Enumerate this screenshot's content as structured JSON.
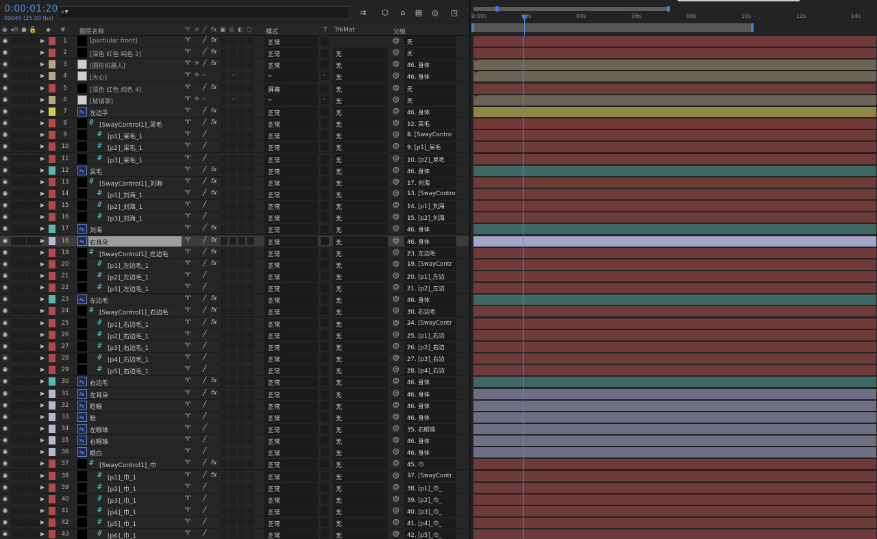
{
  "header": {
    "timecode": "0:00:01:20",
    "frame_info": "00045 (25.00 fps)",
    "search_placeholder": "⌕"
  },
  "columns": {
    "number": "#",
    "layer_name": "图层名称",
    "mode": "模式",
    "t": "T",
    "trkmat": "TrkMat",
    "parent": "父级"
  },
  "timeline": {
    "ticks": [
      "0:00s",
      "02s",
      "04s",
      "06s",
      "08s",
      "10s",
      "12s",
      "14s"
    ],
    "playhead_seconds": 1.8,
    "duration_seconds": 15
  },
  "colors": {
    "red": "#b7464b",
    "tan": "#b5a58a",
    "yellow": "#d8c95a",
    "aqua": "#57b8b1",
    "lavender": "#b9b6d4",
    "bar_red": "#6e3a3a",
    "bar_tan": "#6b6356",
    "bar_yellow": "#8e8648",
    "bar_aqua": "#3d6866",
    "bar_lavender": "#6f6f83",
    "bar_selected": "#a3a6c8",
    "accent": "#3f7fd8"
  },
  "layers": [
    {
      "num": "1",
      "label": "red",
      "thumb": "null",
      "name": "[partiular front]",
      "indent": 0,
      "sw2": "",
      "fx": true,
      "mode": "正常",
      "trk": "",
      "trk_show": false,
      "parent": "无"
    },
    {
      "num": "2",
      "label": "red",
      "thumb": "null",
      "name": "[深色 红色 纯色 2]",
      "indent": 0,
      "sw2": "",
      "fx": true,
      "mode": "正常",
      "trk": "无",
      "trk_show": true,
      "parent": "无"
    },
    {
      "num": "3",
      "label": "tan",
      "thumb": "comp",
      "name": "[圆形机器人]",
      "indent": 0,
      "sw2": "☼",
      "fx": true,
      "mode": "正常",
      "trk": "无",
      "trk_show": true,
      "parent": "46. 身体"
    },
    {
      "num": "4",
      "label": "tan",
      "thumb": "comp",
      "name": "[大心]",
      "indent": 0,
      "sw2": "☼",
      "fx": false,
      "mode": "-",
      "trk": "无",
      "trk_show": true,
      "parent": "46. 身体",
      "dash": true
    },
    {
      "num": "5",
      "label": "red",
      "thumb": "null",
      "name": "[深色 红色 纯色 4]",
      "indent": 0,
      "sw2": "",
      "fx": true,
      "mode": "屏幕",
      "trk": "无",
      "trk_show": true,
      "parent": "无"
    },
    {
      "num": "6",
      "label": "tan",
      "thumb": "comp",
      "name": "[玻璃罩]",
      "indent": 0,
      "sw2": "☼",
      "fx": false,
      "mode": "-",
      "trk": "无",
      "trk_show": true,
      "parent": "无",
      "dash": true
    },
    {
      "num": "7",
      "label": "yellow",
      "thumb": "ps",
      "name": "左边手",
      "indent": 0,
      "sw2": "",
      "fx": true,
      "mode": "正常",
      "trk": "无",
      "trk_show": true,
      "parent": "46. 身体"
    },
    {
      "num": "8",
      "label": "red",
      "thumb": "hash",
      "name": "[SwayControl1]_呆毛",
      "indent": 1,
      "sw2": "",
      "fx": true,
      "mode": "正常",
      "trk": "无",
      "trk_show": true,
      "parent": "12. 呆毛"
    },
    {
      "num": "9",
      "label": "red",
      "thumb": "hash",
      "name": "[p1]_呆毛_1",
      "indent": 2,
      "sw2": "",
      "fx": false,
      "mode": "正常",
      "trk": "无",
      "trk_show": true,
      "parent": "8. [SwayContro"
    },
    {
      "num": "10",
      "label": "red",
      "thumb": "hash",
      "name": "[p2]_呆毛_1",
      "indent": 2,
      "sw2": "",
      "fx": false,
      "mode": "正常",
      "trk": "无",
      "trk_show": true,
      "parent": "9.   [p1]_呆毛"
    },
    {
      "num": "11",
      "label": "red",
      "thumb": "hash",
      "name": "[p3]_呆毛_1",
      "indent": 2,
      "sw2": "",
      "fx": false,
      "mode": "正常",
      "trk": "无",
      "trk_show": true,
      "parent": "10.   [p2]_呆毛"
    },
    {
      "num": "12",
      "label": "aqua",
      "thumb": "ps",
      "name": "呆毛",
      "indent": 0,
      "sw2": "",
      "fx": true,
      "mode": "正常",
      "trk": "无",
      "trk_show": true,
      "parent": "46. 身体"
    },
    {
      "num": "13",
      "label": "red",
      "thumb": "hash",
      "name": "[SwayControl1]_刘海",
      "indent": 1,
      "sw2": "",
      "fx": true,
      "mode": "正常",
      "trk": "无",
      "trk_show": true,
      "parent": "17. 刘海"
    },
    {
      "num": "14",
      "label": "red",
      "thumb": "hash",
      "name": "[p1]_刘海_1",
      "indent": 2,
      "sw2": "",
      "fx": true,
      "mode": "正常",
      "trk": "无",
      "trk_show": true,
      "parent": "13. [SwayContro"
    },
    {
      "num": "15",
      "label": "red",
      "thumb": "hash",
      "name": "[p2]_刘海_1",
      "indent": 2,
      "sw2": "",
      "fx": false,
      "mode": "正常",
      "trk": "无",
      "trk_show": true,
      "parent": "14.   [p1]_刘海"
    },
    {
      "num": "16",
      "label": "red",
      "thumb": "hash",
      "name": "[p3]_刘海_1",
      "indent": 2,
      "sw2": "",
      "fx": false,
      "mode": "正常",
      "trk": "无",
      "trk_show": true,
      "parent": "15.   [p2]_刘海"
    },
    {
      "num": "17",
      "label": "aqua",
      "thumb": "ps",
      "name": "刘海",
      "indent": 0,
      "sw2": "",
      "fx": true,
      "mode": "正常",
      "trk": "无",
      "trk_show": true,
      "parent": "46. 身体"
    },
    {
      "num": "18",
      "label": "lavender",
      "thumb": "ps",
      "name": "右耳朵",
      "indent": 0,
      "sw2": "",
      "fx": true,
      "mode": "正常",
      "trk": "无",
      "trk_show": true,
      "parent": "46. 身体",
      "selected": true
    },
    {
      "num": "19",
      "label": "red",
      "thumb": "hash",
      "name": "[SwayControl1]_左边毛",
      "indent": 1,
      "sw2": "",
      "fx": true,
      "mode": "正常",
      "trk": "无",
      "trk_show": true,
      "parent": "23. 左边毛"
    },
    {
      "num": "20",
      "label": "red",
      "thumb": "hash",
      "name": "[p1]_左边毛_1",
      "indent": 2,
      "sw2": "",
      "fx": true,
      "mode": "正常",
      "trk": "无",
      "trk_show": true,
      "parent": "19. [SwayContr"
    },
    {
      "num": "21",
      "label": "red",
      "thumb": "hash",
      "name": "[p2]_左边毛_1",
      "indent": 2,
      "sw2": "",
      "fx": false,
      "mode": "正常",
      "trk": "无",
      "trk_show": true,
      "parent": "20.   [p1]_左边"
    },
    {
      "num": "22",
      "label": "red",
      "thumb": "hash",
      "name": "[p3]_左边毛_1",
      "indent": 2,
      "sw2": "",
      "fx": false,
      "mode": "正常",
      "trk": "无",
      "trk_show": true,
      "parent": "21.   [p2]_左边"
    },
    {
      "num": "23",
      "label": "aqua",
      "thumb": "ps",
      "name": "左边毛",
      "indent": 0,
      "sw2": "",
      "fx": true,
      "mode": "正常",
      "trk": "无",
      "trk_show": true,
      "parent": "46. 身体"
    },
    {
      "num": "24",
      "label": "red",
      "thumb": "hash",
      "name": "[SwayControl1]_右边毛",
      "indent": 1,
      "sw2": "",
      "fx": true,
      "mode": "正常",
      "trk": "无",
      "trk_show": true,
      "parent": "30. 右边毛"
    },
    {
      "num": "25",
      "label": "red",
      "thumb": "hash",
      "name": "[p1]_右边毛_1",
      "indent": 2,
      "sw2": "",
      "fx": true,
      "mode": "正常",
      "trk": "无",
      "trk_show": true,
      "parent": "24. [SwayContr"
    },
    {
      "num": "26",
      "label": "red",
      "thumb": "hash",
      "name": "[p2]_右边毛_1",
      "indent": 2,
      "sw2": "",
      "fx": false,
      "mode": "正常",
      "trk": "无",
      "trk_show": true,
      "parent": "25.   [p1]_右边"
    },
    {
      "num": "27",
      "label": "red",
      "thumb": "hash",
      "name": "[p3]_右边毛_1",
      "indent": 2,
      "sw2": "",
      "fx": false,
      "mode": "正常",
      "trk": "无",
      "trk_show": true,
      "parent": "26.   [p2]_右边"
    },
    {
      "num": "28",
      "label": "red",
      "thumb": "hash",
      "name": "[p4]_右边毛_1",
      "indent": 2,
      "sw2": "",
      "fx": false,
      "mode": "正常",
      "trk": "无",
      "trk_show": true,
      "parent": "27.   [p3]_右边"
    },
    {
      "num": "29",
      "label": "red",
      "thumb": "hash",
      "name": "[p5]_右边毛_1",
      "indent": 2,
      "sw2": "",
      "fx": false,
      "mode": "正常",
      "trk": "无",
      "trk_show": true,
      "parent": "28.   [p4]_右边"
    },
    {
      "num": "30",
      "label": "aqua",
      "thumb": "ps",
      "name": "右边毛",
      "indent": 0,
      "sw2": "",
      "fx": true,
      "mode": "正常",
      "trk": "无",
      "trk_show": true,
      "parent": "46. 身体"
    },
    {
      "num": "31",
      "label": "lavender",
      "thumb": "ps",
      "name": "左耳朵",
      "indent": 0,
      "sw2": "",
      "fx": true,
      "mode": "正常",
      "trk": "无",
      "trk_show": true,
      "parent": "46. 身体"
    },
    {
      "num": "32",
      "label": "lavender",
      "thumb": "ps",
      "name": "眨眼",
      "indent": 0,
      "sw2": "",
      "fx": false,
      "mode": "正常",
      "trk": "无",
      "trk_show": true,
      "parent": "46. 身体"
    },
    {
      "num": "33",
      "label": "lavender",
      "thumb": "ps",
      "name": "脸",
      "indent": 0,
      "sw2": "",
      "fx": false,
      "mode": "正常",
      "trk": "无",
      "trk_show": true,
      "parent": "46. 身体"
    },
    {
      "num": "34",
      "label": "lavender",
      "thumb": "ps",
      "name": "左眼珠",
      "indent": 0,
      "sw2": "",
      "fx": false,
      "mode": "正常",
      "trk": "无",
      "trk_show": true,
      "parent": "35. 右眼珠"
    },
    {
      "num": "35",
      "label": "lavender",
      "thumb": "ps",
      "name": "右眼珠",
      "indent": 0,
      "sw2": "",
      "fx": false,
      "mode": "正常",
      "trk": "无",
      "trk_show": true,
      "parent": "46. 身体"
    },
    {
      "num": "36",
      "label": "lavender",
      "thumb": "ps",
      "name": "眼白",
      "indent": 0,
      "sw2": "",
      "fx": false,
      "mode": "正常",
      "trk": "无",
      "trk_show": true,
      "parent": "46. 身体"
    },
    {
      "num": "37",
      "label": "red",
      "thumb": "hash",
      "name": "[SwayControl1]_巾",
      "indent": 1,
      "sw2": "",
      "fx": true,
      "mode": "正常",
      "trk": "无",
      "trk_show": true,
      "parent": "45. 巾"
    },
    {
      "num": "38",
      "label": "red",
      "thumb": "hash",
      "name": "[p1]_巾_1",
      "indent": 2,
      "sw2": "",
      "fx": true,
      "mode": "正常",
      "trk": "无",
      "trk_show": true,
      "parent": "37. [SwayContr"
    },
    {
      "num": "39",
      "label": "red",
      "thumb": "hash",
      "name": "[p2]_巾_1",
      "indent": 2,
      "sw2": "",
      "fx": false,
      "mode": "正常",
      "trk": "无",
      "trk_show": true,
      "parent": "38.   [p1]_巾_"
    },
    {
      "num": "40",
      "label": "red",
      "thumb": "hash",
      "name": "[p3]_巾_1",
      "indent": 2,
      "sw2": "",
      "fx": false,
      "mode": "正常",
      "trk": "无",
      "trk_show": true,
      "parent": "39.   [p2]_巾_"
    },
    {
      "num": "41",
      "label": "red",
      "thumb": "hash",
      "name": "[p4]_巾_1",
      "indent": 2,
      "sw2": "",
      "fx": false,
      "mode": "正常",
      "trk": "无",
      "trk_show": true,
      "parent": "40.   [p3]_巾_"
    },
    {
      "num": "42",
      "label": "red",
      "thumb": "hash",
      "name": "[p5]_巾_1",
      "indent": 2,
      "sw2": "",
      "fx": false,
      "mode": "正常",
      "trk": "无",
      "trk_show": true,
      "parent": "41.   [p4]_巾_"
    },
    {
      "num": "43",
      "label": "red",
      "thumb": "hash",
      "name": "[p6]_巾_1",
      "indent": 2,
      "sw2": "",
      "fx": false,
      "mode": "正常",
      "trk": "无",
      "trk_show": true,
      "parent": "42.   [p5]_巾_"
    }
  ]
}
